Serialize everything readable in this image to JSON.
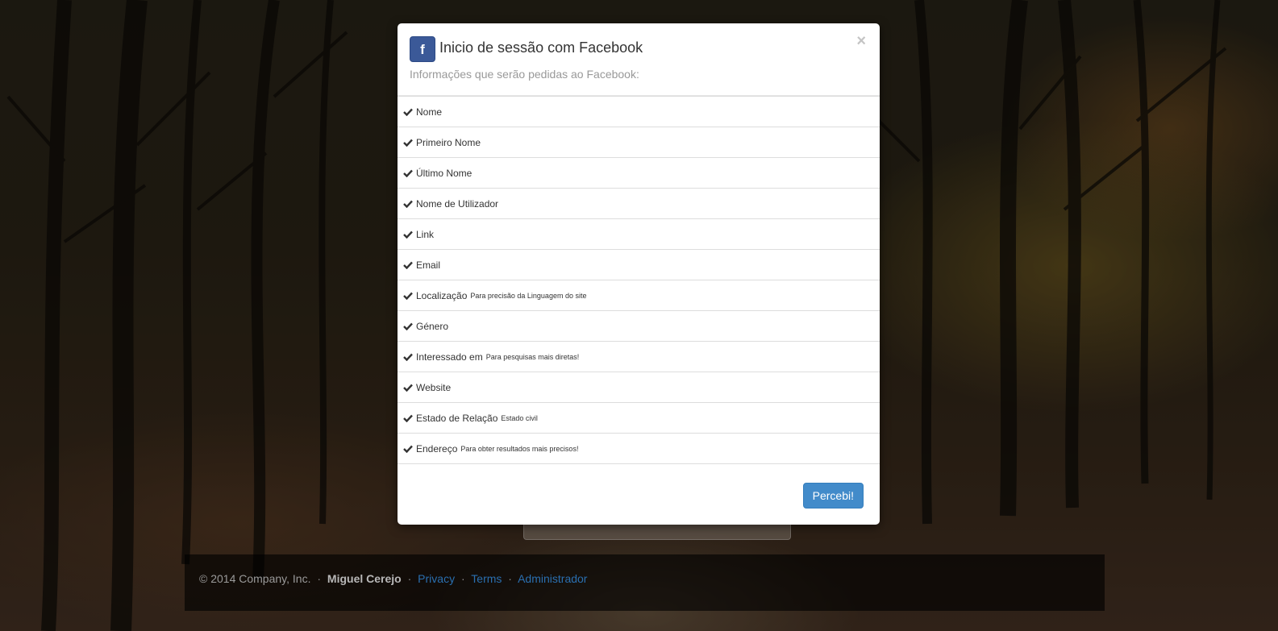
{
  "modal": {
    "title": "Inicio de sessão com Facebook",
    "subtitle": "Informações que serão pedidas ao Facebook:",
    "fb_letter": "f",
    "close_glyph": "×",
    "items": [
      {
        "label": "Nome",
        "note": ""
      },
      {
        "label": "Primeiro Nome",
        "note": ""
      },
      {
        "label": "Último Nome",
        "note": ""
      },
      {
        "label": "Nome de Utilizador",
        "note": ""
      },
      {
        "label": "Link",
        "note": ""
      },
      {
        "label": "Email",
        "note": ""
      },
      {
        "label": "Localização",
        "note": "Para precisão da Linguagem do site"
      },
      {
        "label": "Género",
        "note": ""
      },
      {
        "label": "Interessado em",
        "note": "Para pesquisas mais diretas!"
      },
      {
        "label": "Website",
        "note": ""
      },
      {
        "label": "Estado de Relação",
        "note": "Estado civil"
      },
      {
        "label": "Endereço",
        "note": "Para obter resultados mais precisos!"
      }
    ],
    "confirm_label": "Percebi!"
  },
  "footer": {
    "copyright": "© 2014 Company, Inc.",
    "author": "Miguel Cerejo",
    "links": [
      "Privacy",
      "Terms",
      "Administrador"
    ],
    "separator": "·"
  },
  "colors": {
    "facebook_blue": "#3b5998",
    "primary_button": "#428bca",
    "link": "#2a6fb0"
  }
}
